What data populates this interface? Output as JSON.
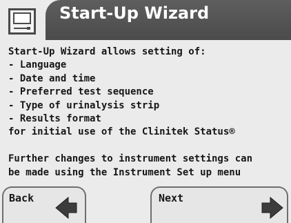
{
  "header": {
    "title": "Start-Up Wizard",
    "icon": "monitor-icon"
  },
  "body": {
    "intro": "Start-Up Wizard allows setting of:",
    "options": [
      "- Language",
      "- Date and time",
      "- Preferred test sequence",
      "- Type of urinalysis strip",
      "- Results format"
    ],
    "closing": "for initial use of the Clinitek Status®",
    "note_lines": [
      "Further changes to instrument settings can",
      "be made using the Instrument Set up menu"
    ]
  },
  "buttons": {
    "back_label": "Back",
    "back_icon": "arrow-left-icon",
    "next_label": "Next",
    "next_icon": "arrow-right-icon"
  },
  "colors": {
    "title_bar": "#555555",
    "background": "#ebebeb",
    "text": "#161616"
  }
}
